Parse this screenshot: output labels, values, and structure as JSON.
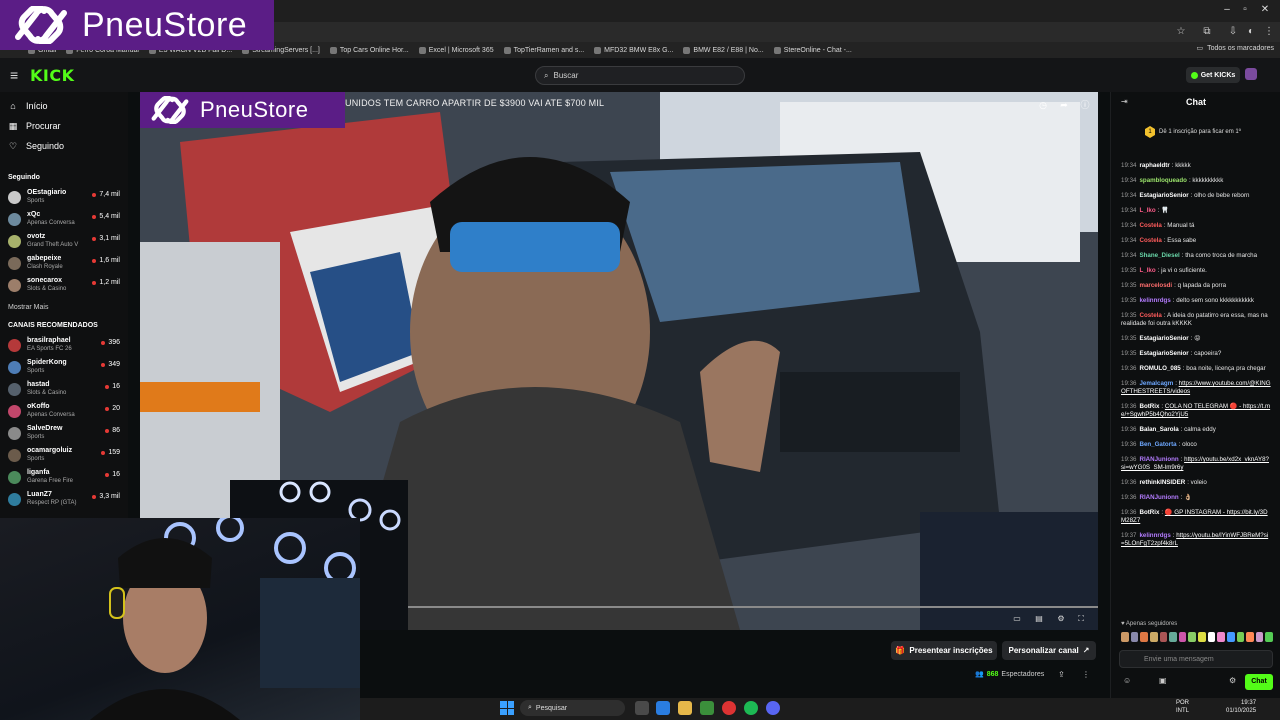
{
  "brand": {
    "name": "PneuStore"
  },
  "browser": {
    "bookmarks": [
      "Gmail",
      "Ferro Coroa Manual",
      "E3 WAGN V2B Fail D...",
      "StreamingServers [...]",
      "Top Cars Online Hor...",
      "Excel | Microsoft 365",
      "TopTierRamen and s...",
      "MFD32 BMW E8x G...",
      "BMW E82 / E88 | No...",
      "StereOnline - Chat -..."
    ],
    "bookmarks_right": "Todos os marcadores"
  },
  "header": {
    "logo": "KICK",
    "search_placeholder": "Buscar",
    "get_kicks": "Get KICKs"
  },
  "sidebar": {
    "nav": [
      {
        "label": "Início",
        "icon": "home-icon"
      },
      {
        "label": "Procurar",
        "icon": "browse-icon"
      },
      {
        "label": "Seguindo",
        "icon": "heart-icon"
      }
    ],
    "following_title": "Seguindo",
    "following": [
      {
        "name": "OEstagiario",
        "game": "Sports",
        "count": "7,4 mil",
        "color": "#c9c9c9"
      },
      {
        "name": "xQc",
        "game": "Apenas Conversa",
        "count": "5,4 mil",
        "color": "#6d8a9e"
      },
      {
        "name": "ovotz",
        "game": "Grand Theft Auto V",
        "count": "3,1 mil",
        "color": "#a8b26c"
      },
      {
        "name": "gabepeixe",
        "game": "Clash Royale",
        "count": "1,6 mil",
        "color": "#7a6a5a"
      },
      {
        "name": "sonecarox",
        "game": "Slots & Casino",
        "count": "1,2 mil",
        "color": "#9c7e6a"
      }
    ],
    "show_more": "Mostrar Mais",
    "recommended_title": "CANAIS RECOMENDADOS",
    "recommended": [
      {
        "name": "brasilraphael",
        "game": "EA Sports FC 26",
        "count": "396",
        "color": "#b5393a"
      },
      {
        "name": "SpiderKong",
        "game": "Sports",
        "count": "349",
        "color": "#4e7db6"
      },
      {
        "name": "hastad",
        "game": "Slots & Casino",
        "count": "16",
        "color": "#55606c"
      },
      {
        "name": "oKoffo",
        "game": "Apenas Conversa",
        "count": "20",
        "color": "#c2476b"
      },
      {
        "name": "SalveDrew",
        "game": "Sports",
        "count": "86",
        "color": "#8a8a8a"
      },
      {
        "name": "ocamargoluiz",
        "game": "Sports",
        "count": "159",
        "color": "#6b5b4b"
      },
      {
        "name": "liganfa",
        "game": "Garena Free Fire",
        "count": "16",
        "color": "#4b8a5b"
      },
      {
        "name": "LuanZ7",
        "game": "Respect RP (GTA)",
        "count": "3,3 mil",
        "color": "#2f7d9e"
      }
    ]
  },
  "video": {
    "ticker": "UNIDOS TEM CARRO APARTIR DE $3900 VAI ATE $700 MIL"
  },
  "under_video": {
    "present": "Presentear inscrições",
    "customize": "Personalizar canal",
    "viewers_count": "868",
    "viewers_label": "Espectadores"
  },
  "chat": {
    "title": "Chat",
    "goal_number": "1",
    "goal_text": "Dê 1 inscrição para ficar em 1º",
    "messages": [
      {
        "time": "19:34",
        "user": "raphaeldtr",
        "color": "#ffffff",
        "text": "kkkkk"
      },
      {
        "time": "19:34",
        "user": "spambloqueado",
        "color": "#9be36b",
        "text": "kkkkkkkkkk"
      },
      {
        "time": "19:34",
        "user": "EstagiarioSenior",
        "color": "#ffffff",
        "text": "olho de bebe reborn"
      },
      {
        "time": "19:34",
        "user": "L_lko",
        "color": "#ff5c8a",
        "text": "🦷"
      },
      {
        "time": "19:34",
        "user": "Costela",
        "color": "#ff5c5c",
        "text": "Manual tá"
      },
      {
        "time": "19:34",
        "user": "Costela",
        "color": "#ff5c5c",
        "text": "Essa sabe"
      },
      {
        "time": "19:34",
        "user": "Shane_Diesel",
        "color": "#68d6a8",
        "text": "tha como troca de marcha"
      },
      {
        "time": "19:35",
        "user": "L_lko",
        "color": "#ff5c8a",
        "text": "ja vi o suficiente."
      },
      {
        "time": "19:35",
        "user": "marcelosdi",
        "color": "#ff6e6e",
        "text": "q lapada da porra"
      },
      {
        "time": "19:35",
        "user": "kelinnrdgs",
        "color": "#b47cff",
        "text": "delto sem sono kkkkkkkkkkk"
      },
      {
        "time": "19:35",
        "user": "Costela",
        "color": "#ff5c5c",
        "text": "A ideia do patatirro era essa, mas na realidade foi outra kKKKK"
      },
      {
        "time": "19:35",
        "user": "EstagiarioSenior",
        "color": "#ffffff",
        "text": "😡"
      },
      {
        "time": "19:35",
        "user": "EstagiarioSenior",
        "color": "#ffffff",
        "text": "capoeira?"
      },
      {
        "time": "19:36",
        "user": "ROMULO_085",
        "color": "#ffffff",
        "text": "boa noite, licença pra chegar"
      },
      {
        "time": "19:36",
        "user": "Jemalcagm",
        "color": "#6ea8ff",
        "text": "https://www.youtube.com/@KINGOFTHESTREETS/videos"
      },
      {
        "time": "19:36",
        "user": "BotRix",
        "color": "#ffffff",
        "text": "COLA NO TELEGRAM 🔴 - https://t.me/+SgwhP5b4Qho2YjU5"
      },
      {
        "time": "19:36",
        "user": "Balan_Sarola",
        "color": "#ffffff",
        "text": "calma eddy"
      },
      {
        "time": "19:36",
        "user": "Ben_Gatorta",
        "color": "#6ea8ff",
        "text": "oloco"
      },
      {
        "time": "19:36",
        "user": "RIANJunionn",
        "color": "#b47cff",
        "text": "https://youtu.be/xd2x_vknAY8?si=wYG0S_SM-lm9r6y"
      },
      {
        "time": "19:36",
        "user": "rethinkINSIDER",
        "color": "#ffffff",
        "text": "voleio"
      },
      {
        "time": "19:36",
        "user": "RIANJunionn",
        "color": "#b47cff",
        "text": "👌🏼"
      },
      {
        "time": "19:36",
        "user": "BotRix",
        "color": "#ffffff",
        "text": "🔴 GP INSTAGRAM - https://bit.ly/3DM28Z7"
      },
      {
        "time": "19:37",
        "user": "kelinnrdgs",
        "color": "#b47cff",
        "text": "https://youtu.be/lYinWFJBReM?si=5LOnFgT2zpf4k8rL"
      }
    ],
    "followers_only": "Apenas seguidores",
    "input_placeholder": "Envie uma mensagem",
    "send_label": "Chat"
  },
  "taskbar": {
    "search": "Pesquisar",
    "lang_top": "POR",
    "lang_bottom": "INTL",
    "time": "19:37",
    "date": "01/10/2025"
  }
}
